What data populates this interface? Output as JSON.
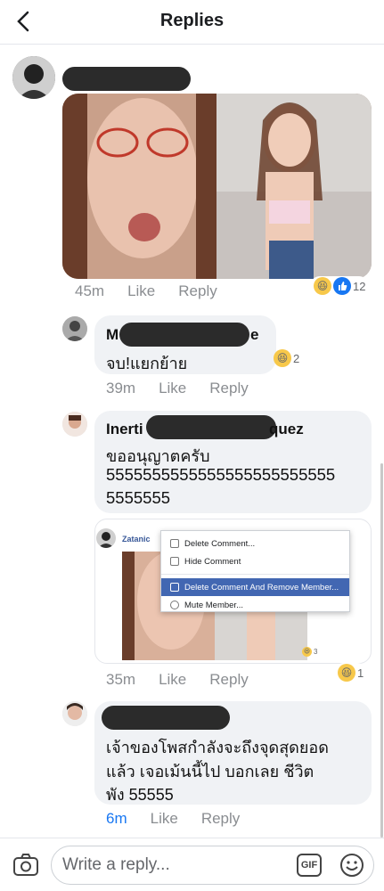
{
  "header": {
    "title": "Replies"
  },
  "post": {
    "time": "45m",
    "like_label": "Like",
    "reply_label": "Reply",
    "reaction_count": "12"
  },
  "comments": [
    {
      "name_visible_start": "M",
      "name_visible_end": "e",
      "text": "จบ!แยกย้าย",
      "time": "39m",
      "like_label": "Like",
      "reply_label": "Reply",
      "reaction_count": "2"
    },
    {
      "name_visible_start": "Inerti",
      "name_visible_end": "quez",
      "text_line1": "ขออนุญาตครับ",
      "text_line2": "5555555555555555555555555",
      "text_line3": "5555555",
      "time": "35m",
      "like_label": "Like",
      "reply_label": "Reply",
      "reaction_count": "1",
      "embedded": {
        "author": "Zatanic",
        "reaction_count": "3",
        "menu": [
          {
            "label": "Delete Comment...",
            "icon": "trash-icon"
          },
          {
            "label": "Hide Comment",
            "icon": "hide-icon"
          },
          {
            "label": "Delete Comment And Remove Member...",
            "icon": "close-icon",
            "highlighted": true
          },
          {
            "label": "Mute Member...",
            "icon": "mute-icon"
          }
        ]
      }
    },
    {
      "text_line1": "เจ้าของโพสกำลังจะถึงจุดสุดยอด",
      "text_line2": "แล้ว เจอเม้นนี้ไป บอกเลย ชีวิต",
      "text_line3": "พัง 55555",
      "time": "6m",
      "like_label": "Like",
      "reply_label": "Reply"
    }
  ],
  "composer": {
    "placeholder": "Write a reply...",
    "gif_label": "GIF"
  },
  "colors": {
    "accent": "#1877f2",
    "bubble": "#f0f2f5",
    "menu_highlight": "#4267b2"
  }
}
